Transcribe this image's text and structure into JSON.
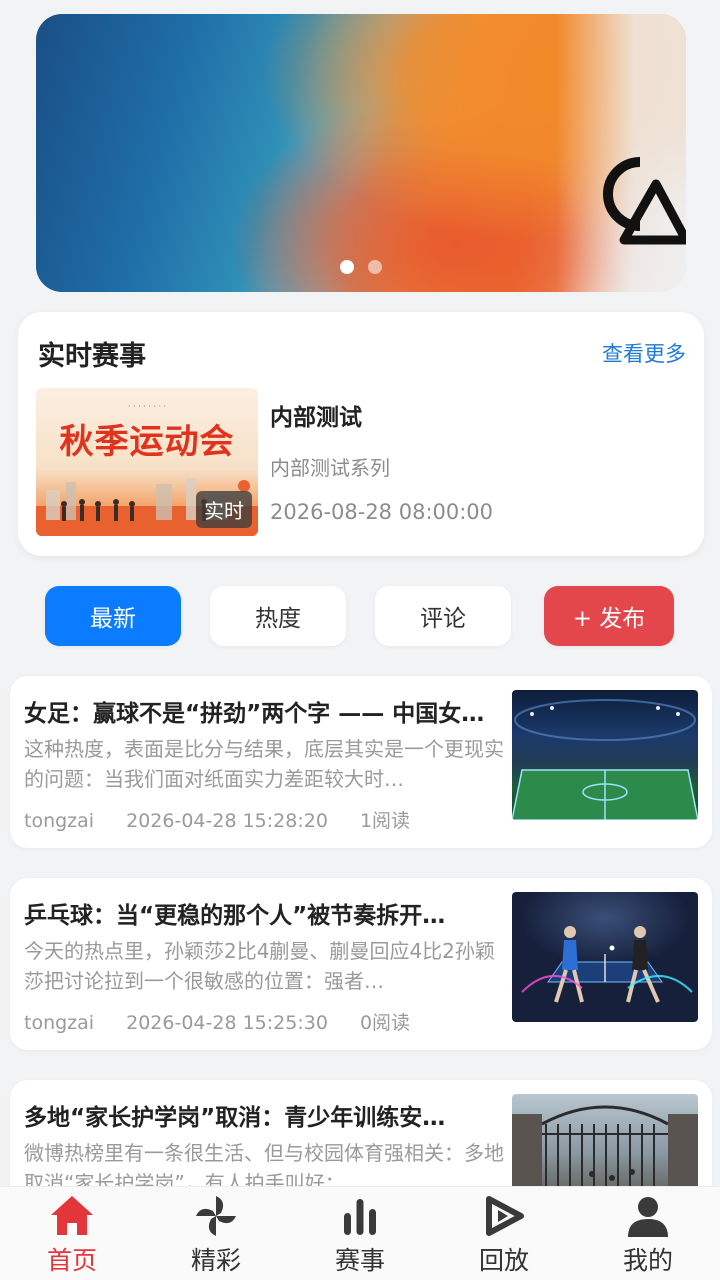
{
  "banner": {
    "dots": 2,
    "active_dot": 0,
    "colors": {
      "blue": "#1f6ea8",
      "orange": "#f08030"
    }
  },
  "live": {
    "title": "实时赛事",
    "more": "查看更多",
    "item": {
      "thumb_title": "秋季运动会",
      "badge": "实时",
      "name": "内部测试",
      "series": "内部测试系列",
      "time": "2026-08-28 08:00:00"
    }
  },
  "filters": {
    "latest": "最新",
    "hot": "热度",
    "comment": "评论",
    "publish": "+ 发布",
    "active": "latest"
  },
  "news": [
    {
      "title": "女足：赢球不是“拼劲”两个字 —— 中国女足…",
      "desc": "这种热度，表面是比分与结果，底层其实是一个更现实的问题：当我们面对纸面实力差距较大时…",
      "author": "tongzai",
      "time": "2026-04-28 15:28:20",
      "reads": "1阅读",
      "image": "stadium"
    },
    {
      "title": "乒乓球：当“更稳的那个人”被节奏拆开…",
      "desc": "今天的热点里，孙颖莎2比4蒯曼、蒯曼回应4比2孙颖莎把讨论拉到一个很敏感的位置：强者…",
      "author": "tongzai",
      "time": "2026-04-28 15:25:30",
      "reads": "0阅读",
      "image": "table-tennis"
    },
    {
      "title": "多地“家长护学岗”取消：青少年训练安…",
      "desc": "微博热榜里有一条很生活、但与校园体育强相关：多地取消“家长护学岗”，有人拍手叫好；",
      "author": "",
      "time": "",
      "reads": "",
      "image": "school-gate"
    }
  ],
  "nav": {
    "items": [
      {
        "label": "首页",
        "icon": "home-icon"
      },
      {
        "label": "精彩",
        "icon": "pinwheel-icon"
      },
      {
        "label": "赛事",
        "icon": "bar-chart-icon"
      },
      {
        "label": "回放",
        "icon": "playback-icon"
      },
      {
        "label": "我的",
        "icon": "user-icon"
      }
    ],
    "active": 0,
    "active_color": "#e3353a"
  }
}
